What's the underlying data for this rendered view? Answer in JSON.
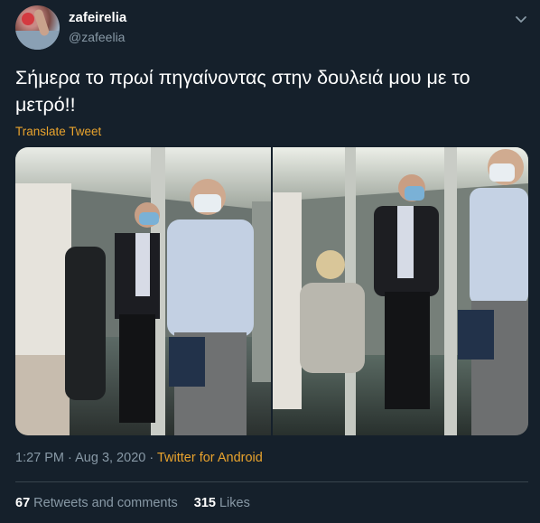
{
  "user": {
    "display_name": "zafeirelia",
    "handle": "@zafeelia"
  },
  "tweet": {
    "text": "Σήμερα το πρωί πηγαίνοντας στην δουλειά μου με το μετρό!!",
    "translate_label": "Translate Tweet"
  },
  "meta": {
    "time": "1:27 PM",
    "date": "Aug 3, 2020",
    "separator": "·",
    "source": "Twitter for Android"
  },
  "stats": {
    "retweets_count": "67",
    "retweets_label": "Retweets and comments",
    "likes_count": "315",
    "likes_label": "Likes"
  },
  "colors": {
    "background": "#15202b",
    "accent": "#e9a32d",
    "secondary_text": "#8899a6",
    "divider": "#38444d"
  },
  "icons": {
    "more": "chevron-down-icon"
  }
}
